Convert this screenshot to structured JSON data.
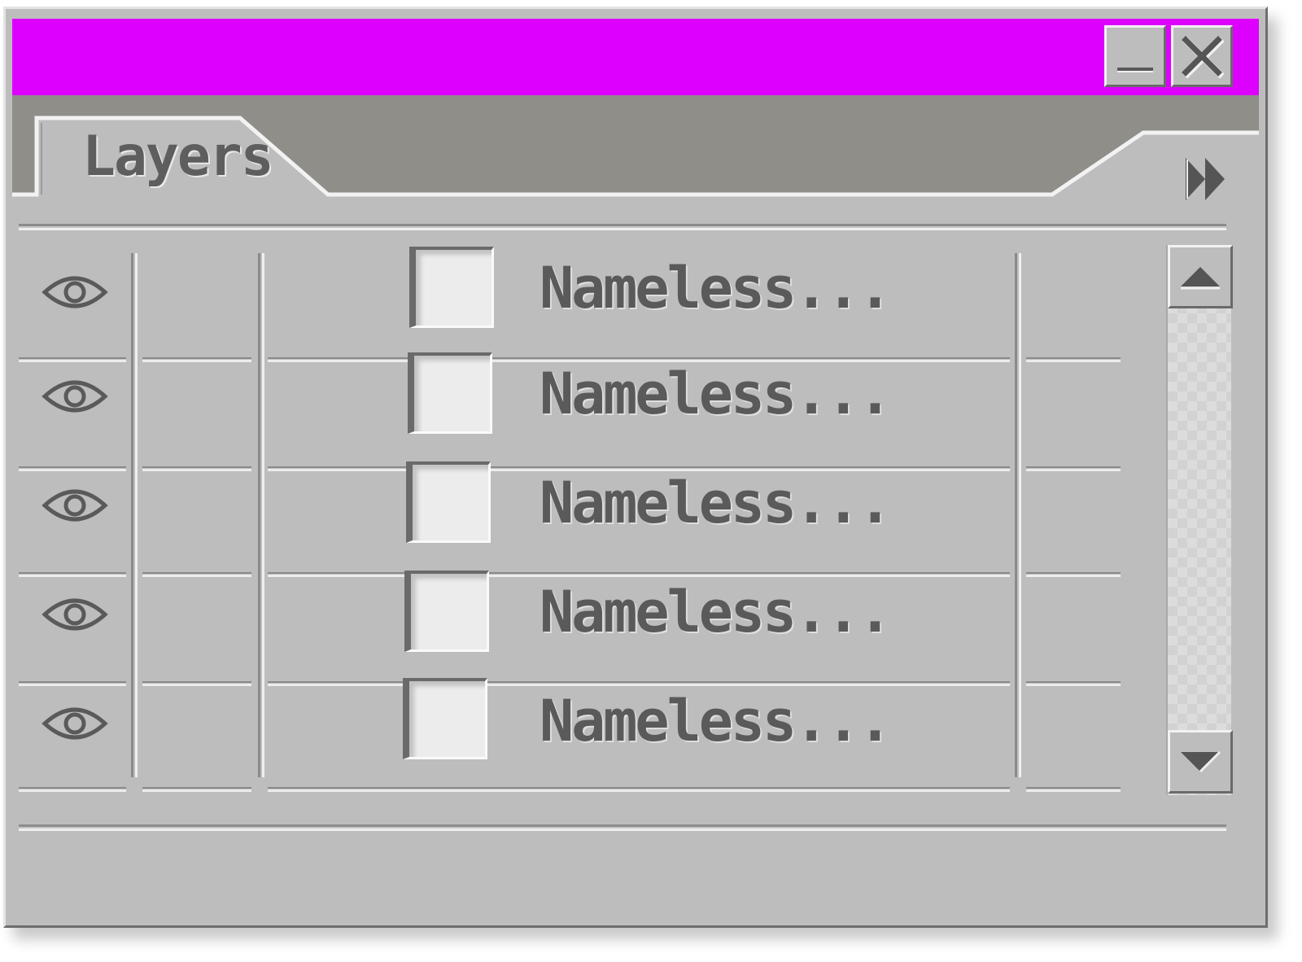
{
  "window": {
    "title": "",
    "titlebar_color": "#dd00ff",
    "minimize_icon": "minimize-icon",
    "close_icon": "close-icon"
  },
  "tabs": [
    {
      "label": "Layers",
      "active": true
    }
  ],
  "panel_menu_icon": "double-chevron-right-icon",
  "layers": [
    {
      "name": "Nameless...",
      "visible": true,
      "visibility_icon": "eye-icon"
    },
    {
      "name": "Nameless...",
      "visible": true,
      "visibility_icon": "eye-icon"
    },
    {
      "name": "Nameless...",
      "visible": true,
      "visibility_icon": "eye-icon"
    },
    {
      "name": "Nameless...",
      "visible": true,
      "visibility_icon": "eye-icon"
    },
    {
      "name": "Nameless...",
      "visible": true,
      "visibility_icon": "eye-icon"
    }
  ],
  "scrollbar": {
    "up_icon": "arrow-up-icon",
    "down_icon": "arrow-down-icon"
  }
}
